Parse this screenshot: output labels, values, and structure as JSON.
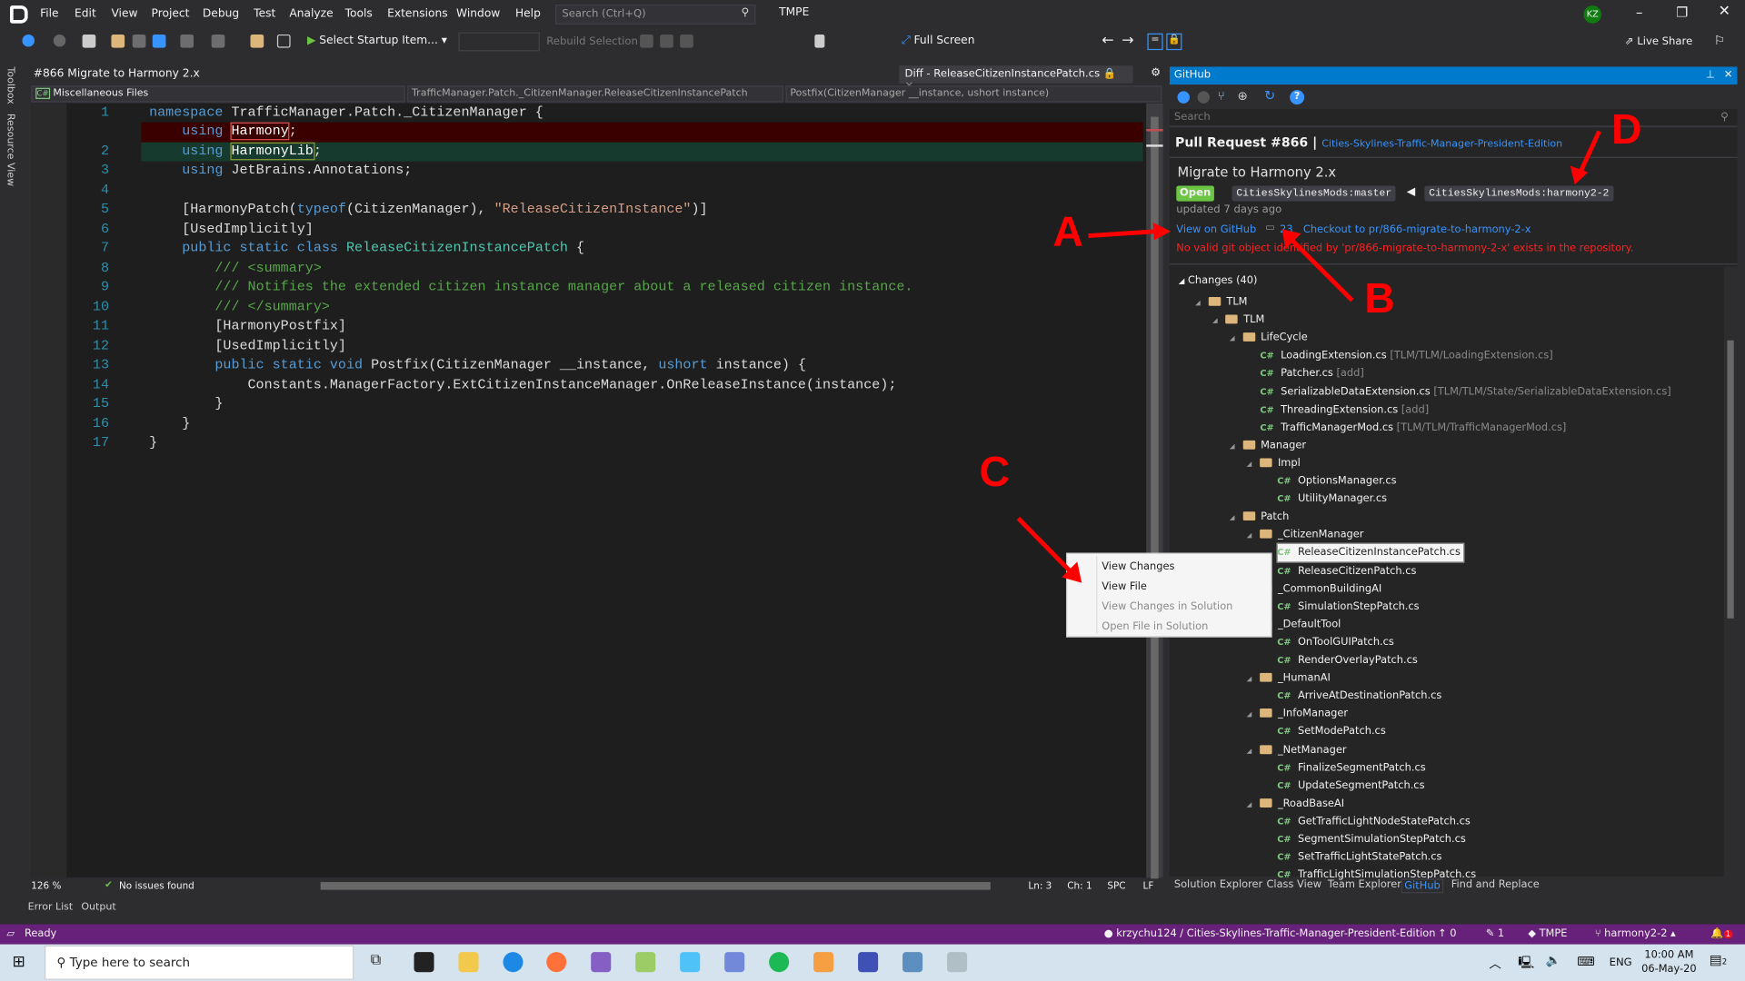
{
  "window": {
    "menu": [
      "File",
      "Edit",
      "View",
      "Project",
      "Debug",
      "Test",
      "Analyze",
      "Tools",
      "Extensions",
      "Window",
      "Help"
    ],
    "search_placeholder": "Search (Ctrl+Q)",
    "solution_name": "TMPE",
    "user_initials": "KZ",
    "user_color": "#107c10"
  },
  "toolbar": {
    "startup_item": "Select Startup Item...",
    "rebuild_selection": "Rebuild Selection",
    "full_screen": "Full Screen",
    "live_share": "Live Share"
  },
  "doc": {
    "title": "#866 Migrate to Harmony 2.x",
    "diff_tab": "Diff - ReleaseCitizenInstancePatch.cs",
    "project_dropdown": "Miscellaneous Files",
    "class_dropdown": "TrafficManager.Patch._CitizenManager.ReleaseCitizenInstancePatch",
    "member_dropdown": "Postfix(CitizenManager __instance, ushort instance)"
  },
  "side_tabs": {
    "toolbox": "Toolbox",
    "resource_view": "Resource View"
  },
  "code": [
    {
      "num": "1",
      "kind": "",
      "tokens": [
        [
          "kw",
          "namespace"
        ],
        [
          "t",
          " TrafficManager.Patch._CitizenManager {"
        ]
      ]
    },
    {
      "num": "",
      "kind": "del",
      "tokens": [
        [
          "t",
          "    "
        ],
        [
          "kw",
          "using"
        ],
        [
          "t",
          " "
        ],
        [
          "hlr",
          "Harmony"
        ],
        [
          "t",
          ";"
        ]
      ]
    },
    {
      "num": "2",
      "kind": "add",
      "tokens": [
        [
          "t",
          "    "
        ],
        [
          "kw",
          "using"
        ],
        [
          "t",
          " "
        ],
        [
          "hlg",
          "HarmonyLib"
        ],
        [
          "t",
          ";"
        ]
      ]
    },
    {
      "num": "3",
      "kind": "",
      "tokens": [
        [
          "t",
          "    "
        ],
        [
          "kw",
          "using"
        ],
        [
          "t",
          " JetBrains.Annotations;"
        ]
      ]
    },
    {
      "num": "4",
      "kind": "",
      "tokens": []
    },
    {
      "num": "5",
      "kind": "",
      "tokens": [
        [
          "t",
          "    [HarmonyPatch("
        ],
        [
          "kw",
          "typeof"
        ],
        [
          "t",
          "(CitizenManager), "
        ],
        [
          "str",
          "\"ReleaseCitizenInstance\""
        ],
        [
          "t",
          ")]"
        ]
      ]
    },
    {
      "num": "6",
      "kind": "",
      "tokens": [
        [
          "t",
          "    [UsedImplicitly]"
        ]
      ]
    },
    {
      "num": "7",
      "kind": "",
      "tokens": [
        [
          "t",
          "    "
        ],
        [
          "kw",
          "public static class"
        ],
        [
          "t",
          " "
        ],
        [
          "ty",
          "ReleaseCitizenInstancePatch"
        ],
        [
          "t",
          " {"
        ]
      ]
    },
    {
      "num": "8",
      "kind": "",
      "tokens": [
        [
          "t",
          "        "
        ],
        [
          "cm",
          "/// <summary>"
        ]
      ]
    },
    {
      "num": "9",
      "kind": "",
      "tokens": [
        [
          "t",
          "        "
        ],
        [
          "cm",
          "/// Notifies the extended citizen instance manager about a released citizen instance."
        ]
      ]
    },
    {
      "num": "10",
      "kind": "",
      "tokens": [
        [
          "t",
          "        "
        ],
        [
          "cm",
          "/// </summary>"
        ]
      ]
    },
    {
      "num": "11",
      "kind": "",
      "tokens": [
        [
          "t",
          "        [HarmonyPostfix]"
        ]
      ]
    },
    {
      "num": "12",
      "kind": "",
      "tokens": [
        [
          "t",
          "        [UsedImplicitly]"
        ]
      ]
    },
    {
      "num": "13",
      "kind": "",
      "tokens": [
        [
          "t",
          "        "
        ],
        [
          "kw",
          "public static void"
        ],
        [
          "t",
          " Postfix(CitizenManager __instance, "
        ],
        [
          "kw",
          "ushort"
        ],
        [
          "t",
          " instance) {"
        ]
      ]
    },
    {
      "num": "14",
      "kind": "",
      "tokens": [
        [
          "t",
          "            Constants.ManagerFactory.ExtCitizenInstanceManager.OnReleaseInstance(instance);"
        ]
      ]
    },
    {
      "num": "15",
      "kind": "",
      "tokens": [
        [
          "t",
          "        }"
        ]
      ]
    },
    {
      "num": "16",
      "kind": "",
      "tokens": [
        [
          "t",
          "    }"
        ]
      ]
    },
    {
      "num": "17",
      "kind": "",
      "tokens": [
        [
          "t",
          "}"
        ]
      ]
    }
  ],
  "editor_status": {
    "zoom": "126 %",
    "issues": "No issues found",
    "ln": "Ln: 3",
    "ch": "Ch: 1",
    "spc": "SPC",
    "lf": "LF"
  },
  "bottom_tabs": [
    "Error List",
    "Output"
  ],
  "github": {
    "panel_title": "GitHub",
    "search_placeholder": "Search",
    "pr_label": "Pull Request #866",
    "repo_link": "Cities-Skylines-Traffic-Manager-President-Edition",
    "pr_title": "Migrate to Harmony 2.x",
    "state": "Open",
    "base_branch": "CitiesSkylinesMods:master",
    "head_branch": "CitiesSkylinesMods:harmony2-2",
    "updated": "updated 7 days ago",
    "view_on_github": "View on GitHub",
    "comment_count": "23",
    "checkout": "Checkout to pr/866-migrate-to-harmony-2-x",
    "error": "No valid git object identified by 'pr/866-migrate-to-harmony-2-x' exists in the repository.",
    "changes": "Changes (40)",
    "open_color": "#6cc644",
    "link_color": "#3794ff",
    "error_color": "#ff2020"
  },
  "tree": [
    {
      "level": 0,
      "type": "folder",
      "name": "TLM"
    },
    {
      "level": 1,
      "type": "folder",
      "name": "TLM"
    },
    {
      "level": 2,
      "type": "folder",
      "name": "LifeCycle"
    },
    {
      "level": 3,
      "type": "file",
      "name": "LoadingExtension.cs",
      "path": "[TLM/TLM/LoadingExtension.cs]"
    },
    {
      "level": 3,
      "type": "file",
      "name": "Patcher.cs",
      "path": "[add]"
    },
    {
      "level": 3,
      "type": "file",
      "name": "SerializableDataExtension.cs",
      "path": "[TLM/TLM/State/SerializableDataExtension.cs]"
    },
    {
      "level": 3,
      "type": "file",
      "name": "ThreadingExtension.cs",
      "path": "[add]"
    },
    {
      "level": 3,
      "type": "file",
      "name": "TrafficManagerMod.cs",
      "path": "[TLM/TLM/TrafficManagerMod.cs]"
    },
    {
      "level": 2,
      "type": "folder",
      "name": "Manager"
    },
    {
      "level": 3,
      "type": "folder",
      "name": "Impl"
    },
    {
      "level": 4,
      "type": "file",
      "name": "OptionsManager.cs"
    },
    {
      "level": 4,
      "type": "file",
      "name": "UtilityManager.cs"
    },
    {
      "level": 2,
      "type": "folder",
      "name": "Patch"
    },
    {
      "level": 3,
      "type": "folder",
      "name": "_CitizenManager"
    },
    {
      "level": 4,
      "type": "file",
      "name": "ReleaseCitizenInstancePatch.cs",
      "selected": true
    },
    {
      "level": 4,
      "type": "file",
      "name": "ReleaseCitizenPatch.cs"
    },
    {
      "level": 3,
      "type": "folder",
      "name": "_CommonBuildingAI"
    },
    {
      "level": 4,
      "type": "file",
      "name": "SimulationStepPatch.cs"
    },
    {
      "level": 3,
      "type": "folder",
      "name": "_DefaultTool"
    },
    {
      "level": 4,
      "type": "file",
      "name": "OnToolGUIPatch.cs"
    },
    {
      "level": 4,
      "type": "file",
      "name": "RenderOverlayPatch.cs"
    },
    {
      "level": 3,
      "type": "folder",
      "name": "_HumanAI"
    },
    {
      "level": 4,
      "type": "file",
      "name": "ArriveAtDestinationPatch.cs"
    },
    {
      "level": 3,
      "type": "folder",
      "name": "_InfoManager"
    },
    {
      "level": 4,
      "type": "file",
      "name": "SetModePatch.cs"
    },
    {
      "level": 3,
      "type": "folder",
      "name": "_NetManager"
    },
    {
      "level": 4,
      "type": "file",
      "name": "FinalizeSegmentPatch.cs"
    },
    {
      "level": 4,
      "type": "file",
      "name": "UpdateSegmentPatch.cs"
    },
    {
      "level": 3,
      "type": "folder",
      "name": "_RoadBaseAI"
    },
    {
      "level": 4,
      "type": "file",
      "name": "GetTrafficLightNodeStatePatch.cs"
    },
    {
      "level": 4,
      "type": "file",
      "name": "SegmentSimulationStepPatch.cs"
    },
    {
      "level": 4,
      "type": "file",
      "name": "SetTrafficLightStatePatch.cs"
    },
    {
      "level": 4,
      "type": "file",
      "name": "TrafficLightSimulationStepPatch.cs"
    }
  ],
  "context_menu": [
    {
      "label": "View Changes",
      "enabled": true
    },
    {
      "label": "View File",
      "enabled": true
    },
    {
      "label": "View Changes in Solution",
      "enabled": false
    },
    {
      "label": "Open File in Solution",
      "enabled": false
    }
  ],
  "panel_tabs": [
    {
      "label": "Solution Explorer"
    },
    {
      "label": "Class View"
    },
    {
      "label": "Team Explorer"
    },
    {
      "label": "GitHub",
      "active": true
    },
    {
      "label": "Find and Replace"
    }
  ],
  "statusbar": {
    "ready": "Ready",
    "repo": "krzychu124 / Cities-Skylines-Traffic-Manager-President-Edition",
    "push": "0",
    "pending": "1",
    "solution": "TMPE",
    "branch": "harmony2-2",
    "notifications": "1",
    "bg": "#68217a"
  },
  "annotations": [
    "A",
    "B",
    "C",
    "D"
  ],
  "taskbar": {
    "search_placeholder": "Type here to search",
    "lang": "ENG",
    "time": "10:00 AM",
    "date": "06-May-20",
    "notif_count": "2",
    "bg": "#d4e3ee"
  }
}
